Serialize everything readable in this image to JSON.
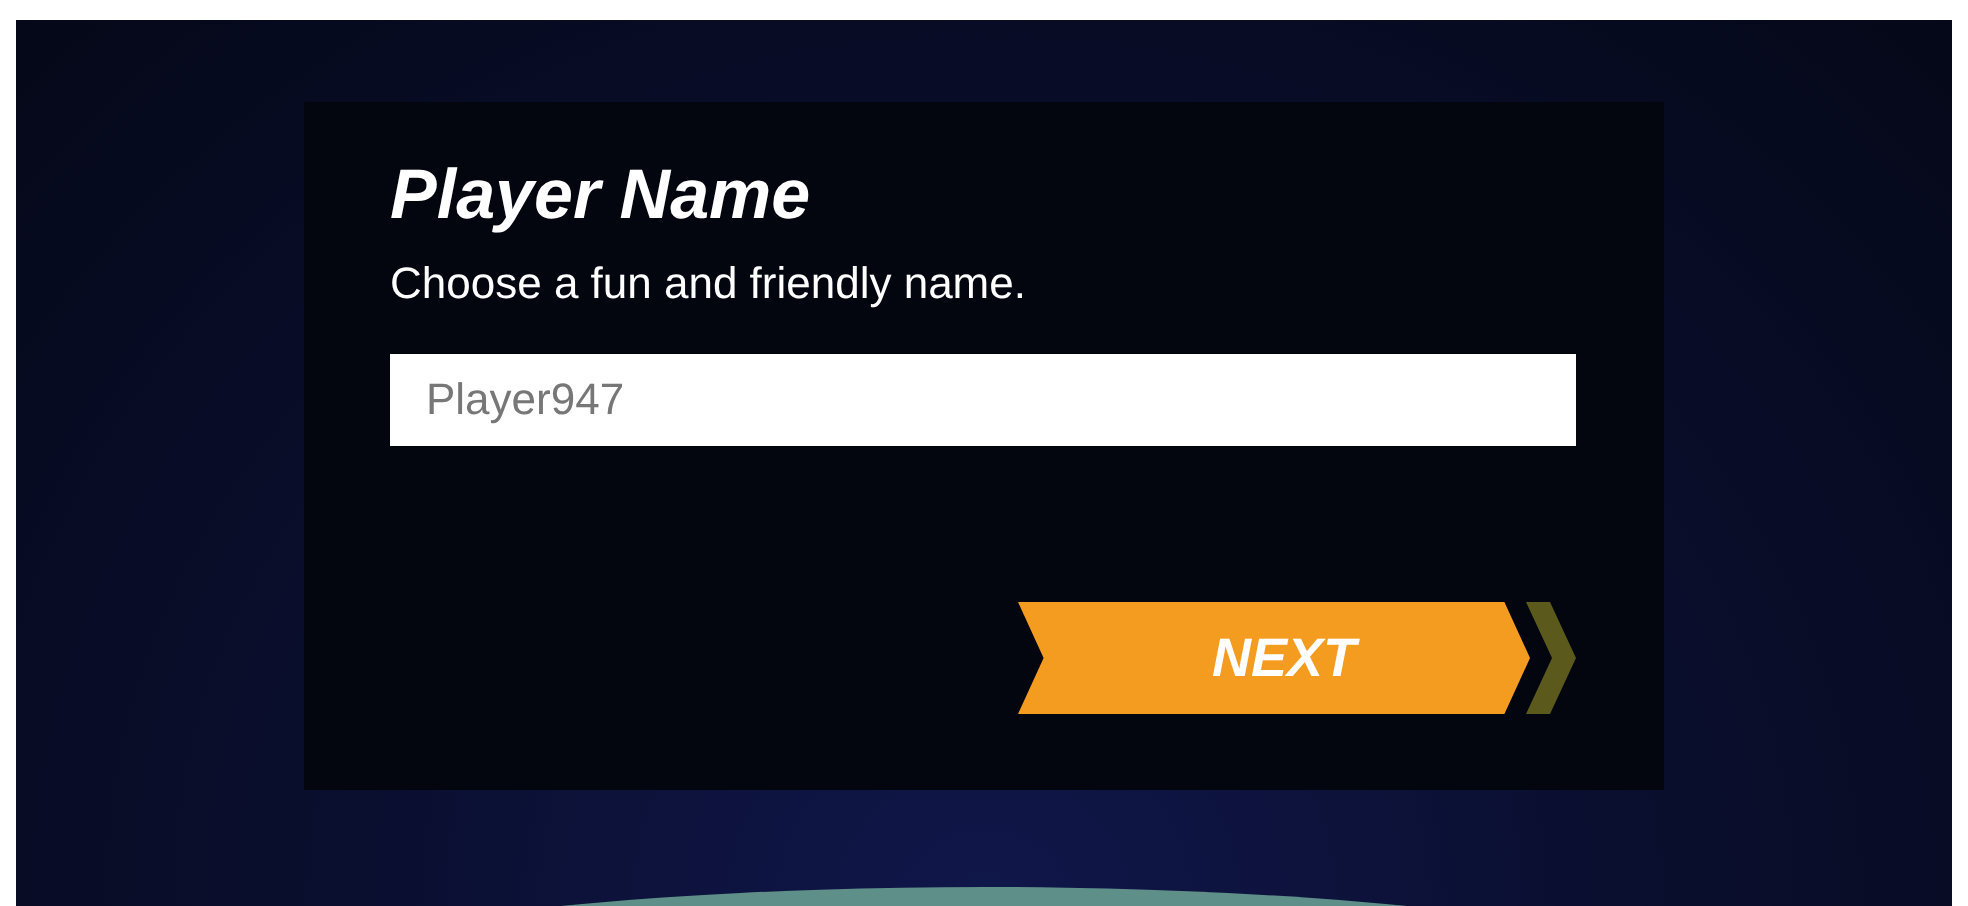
{
  "dialog": {
    "title": "Player Name",
    "subtitle": "Choose a fun and friendly name."
  },
  "name_field": {
    "placeholder": "Player947"
  },
  "next_button": {
    "label": "NEXT"
  }
}
